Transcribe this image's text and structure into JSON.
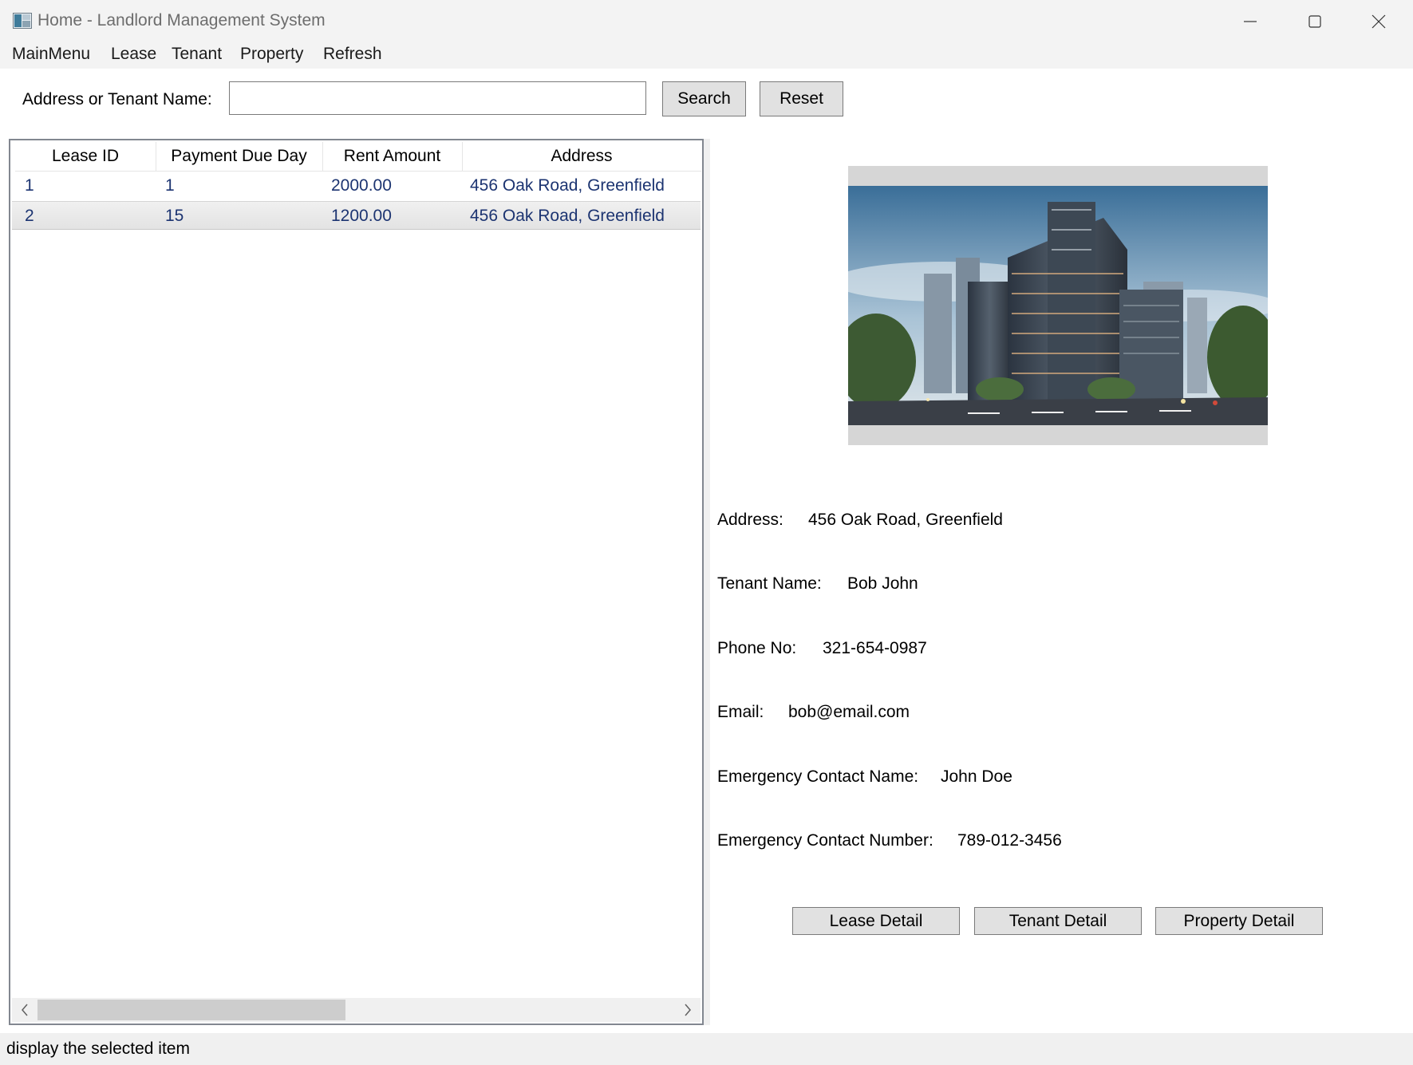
{
  "window": {
    "title": "Home - Landlord Management System"
  },
  "menu": {
    "items": [
      "MainMenu",
      "Lease",
      "Tenant",
      "Property",
      "Refresh"
    ]
  },
  "search": {
    "label": "Address or Tenant Name:",
    "value": "",
    "search_button": "Search",
    "reset_button": "Reset"
  },
  "grid": {
    "columns": [
      "Lease ID",
      "Payment Due Day",
      "Rent Amount",
      "Address"
    ],
    "rows": [
      {
        "lease_id": "1",
        "due_day": "1",
        "rent": "2000.00",
        "address": "456 Oak Road, Greenfield",
        "selected": false
      },
      {
        "lease_id": "2",
        "due_day": "15",
        "rent": "1200.00",
        "address": "456 Oak Road, Greenfield",
        "selected": true
      }
    ]
  },
  "details": {
    "address": {
      "label": "Address:",
      "value": "456 Oak Road, Greenfield"
    },
    "tenant_name": {
      "label": "Tenant Name:",
      "value": "Bob John"
    },
    "phone": {
      "label": "Phone No:",
      "value": "321-654-0987"
    },
    "email": {
      "label": "Email:",
      "value": "bob@email.com"
    },
    "emergency_name": {
      "label": "Emergency Contact Name:",
      "value": "John Doe"
    },
    "emergency_number": {
      "label": "Emergency Contact Number:",
      "value": "789-012-3456"
    }
  },
  "actions": {
    "lease_detail": "Lease Detail",
    "tenant_detail": "Tenant Detail",
    "property_detail": "Property Detail"
  },
  "status": {
    "text": "display the selected item"
  },
  "colors": {
    "grid_text": "#1c3471",
    "chrome": "#f3f3f3",
    "button": "#e1e1e1"
  }
}
